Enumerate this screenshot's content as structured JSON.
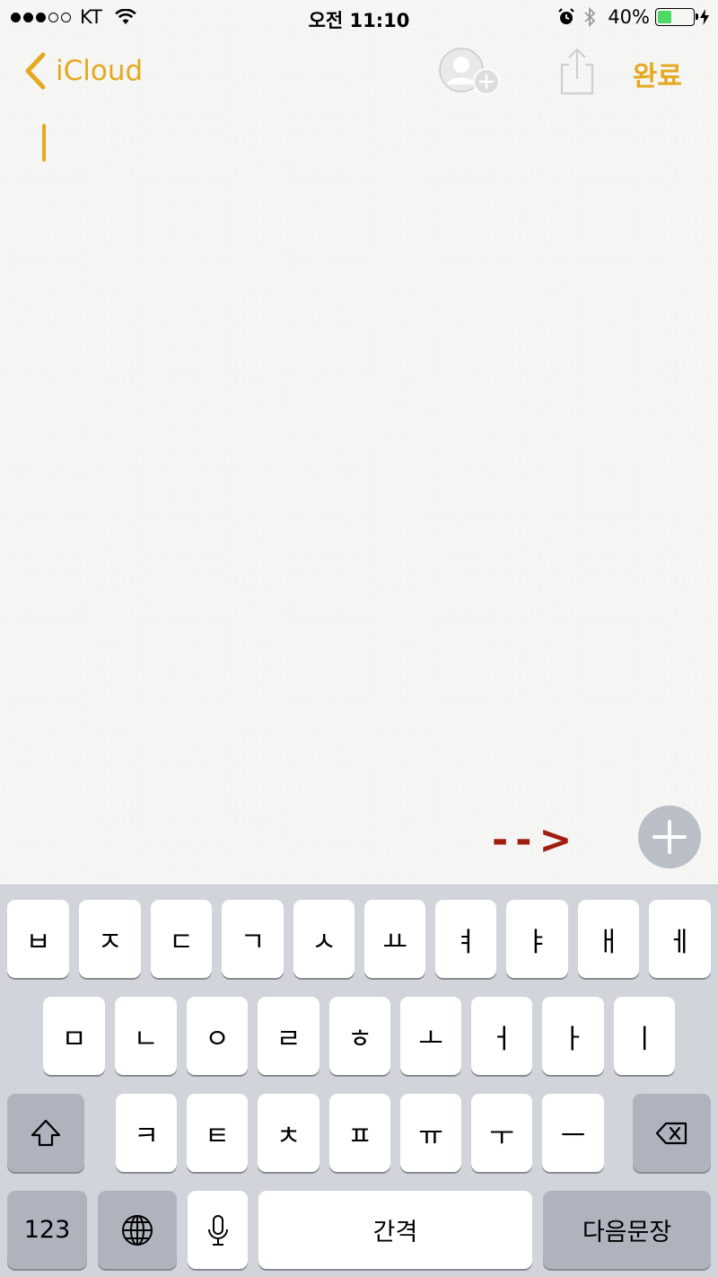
{
  "status_bar": {
    "carrier": "KT",
    "time": "오전 11:10",
    "battery_percent": "40%",
    "battery_level": 0.4,
    "signal_bars_filled": 3,
    "signal_bars_total": 5,
    "icons": [
      "wifi-icon",
      "alarm-icon",
      "bluetooth-icon",
      "battery-icon",
      "charging-icon"
    ]
  },
  "nav": {
    "back_label": "iCloud",
    "done_label": "완료",
    "accent_color": "#e4a920",
    "icons": [
      "chevron-left-icon",
      "add-person-icon",
      "share-icon"
    ]
  },
  "note": {
    "content": ""
  },
  "annotation": {
    "arrow_text": "-->",
    "arrow_color": "#a01e10"
  },
  "keyboard": {
    "row1": [
      "ㅂ",
      "ㅈ",
      "ㄷ",
      "ㄱ",
      "ㅅ",
      "ㅛ",
      "ㅕ",
      "ㅑ",
      "ㅐ",
      "ㅔ"
    ],
    "row2": [
      "ㅁ",
      "ㄴ",
      "ㅇ",
      "ㄹ",
      "ㅎ",
      "ㅗ",
      "ㅓ",
      "ㅏ",
      "ㅣ"
    ],
    "row3": [
      "ㅋ",
      "ㅌ",
      "ㅊ",
      "ㅍ",
      "ㅠ",
      "ㅜ",
      "ㅡ"
    ],
    "numbers_label": "123",
    "space_label": "간격",
    "return_label": "다음문장",
    "icons": [
      "shift-icon",
      "backspace-icon",
      "globe-icon",
      "microphone-icon"
    ]
  }
}
